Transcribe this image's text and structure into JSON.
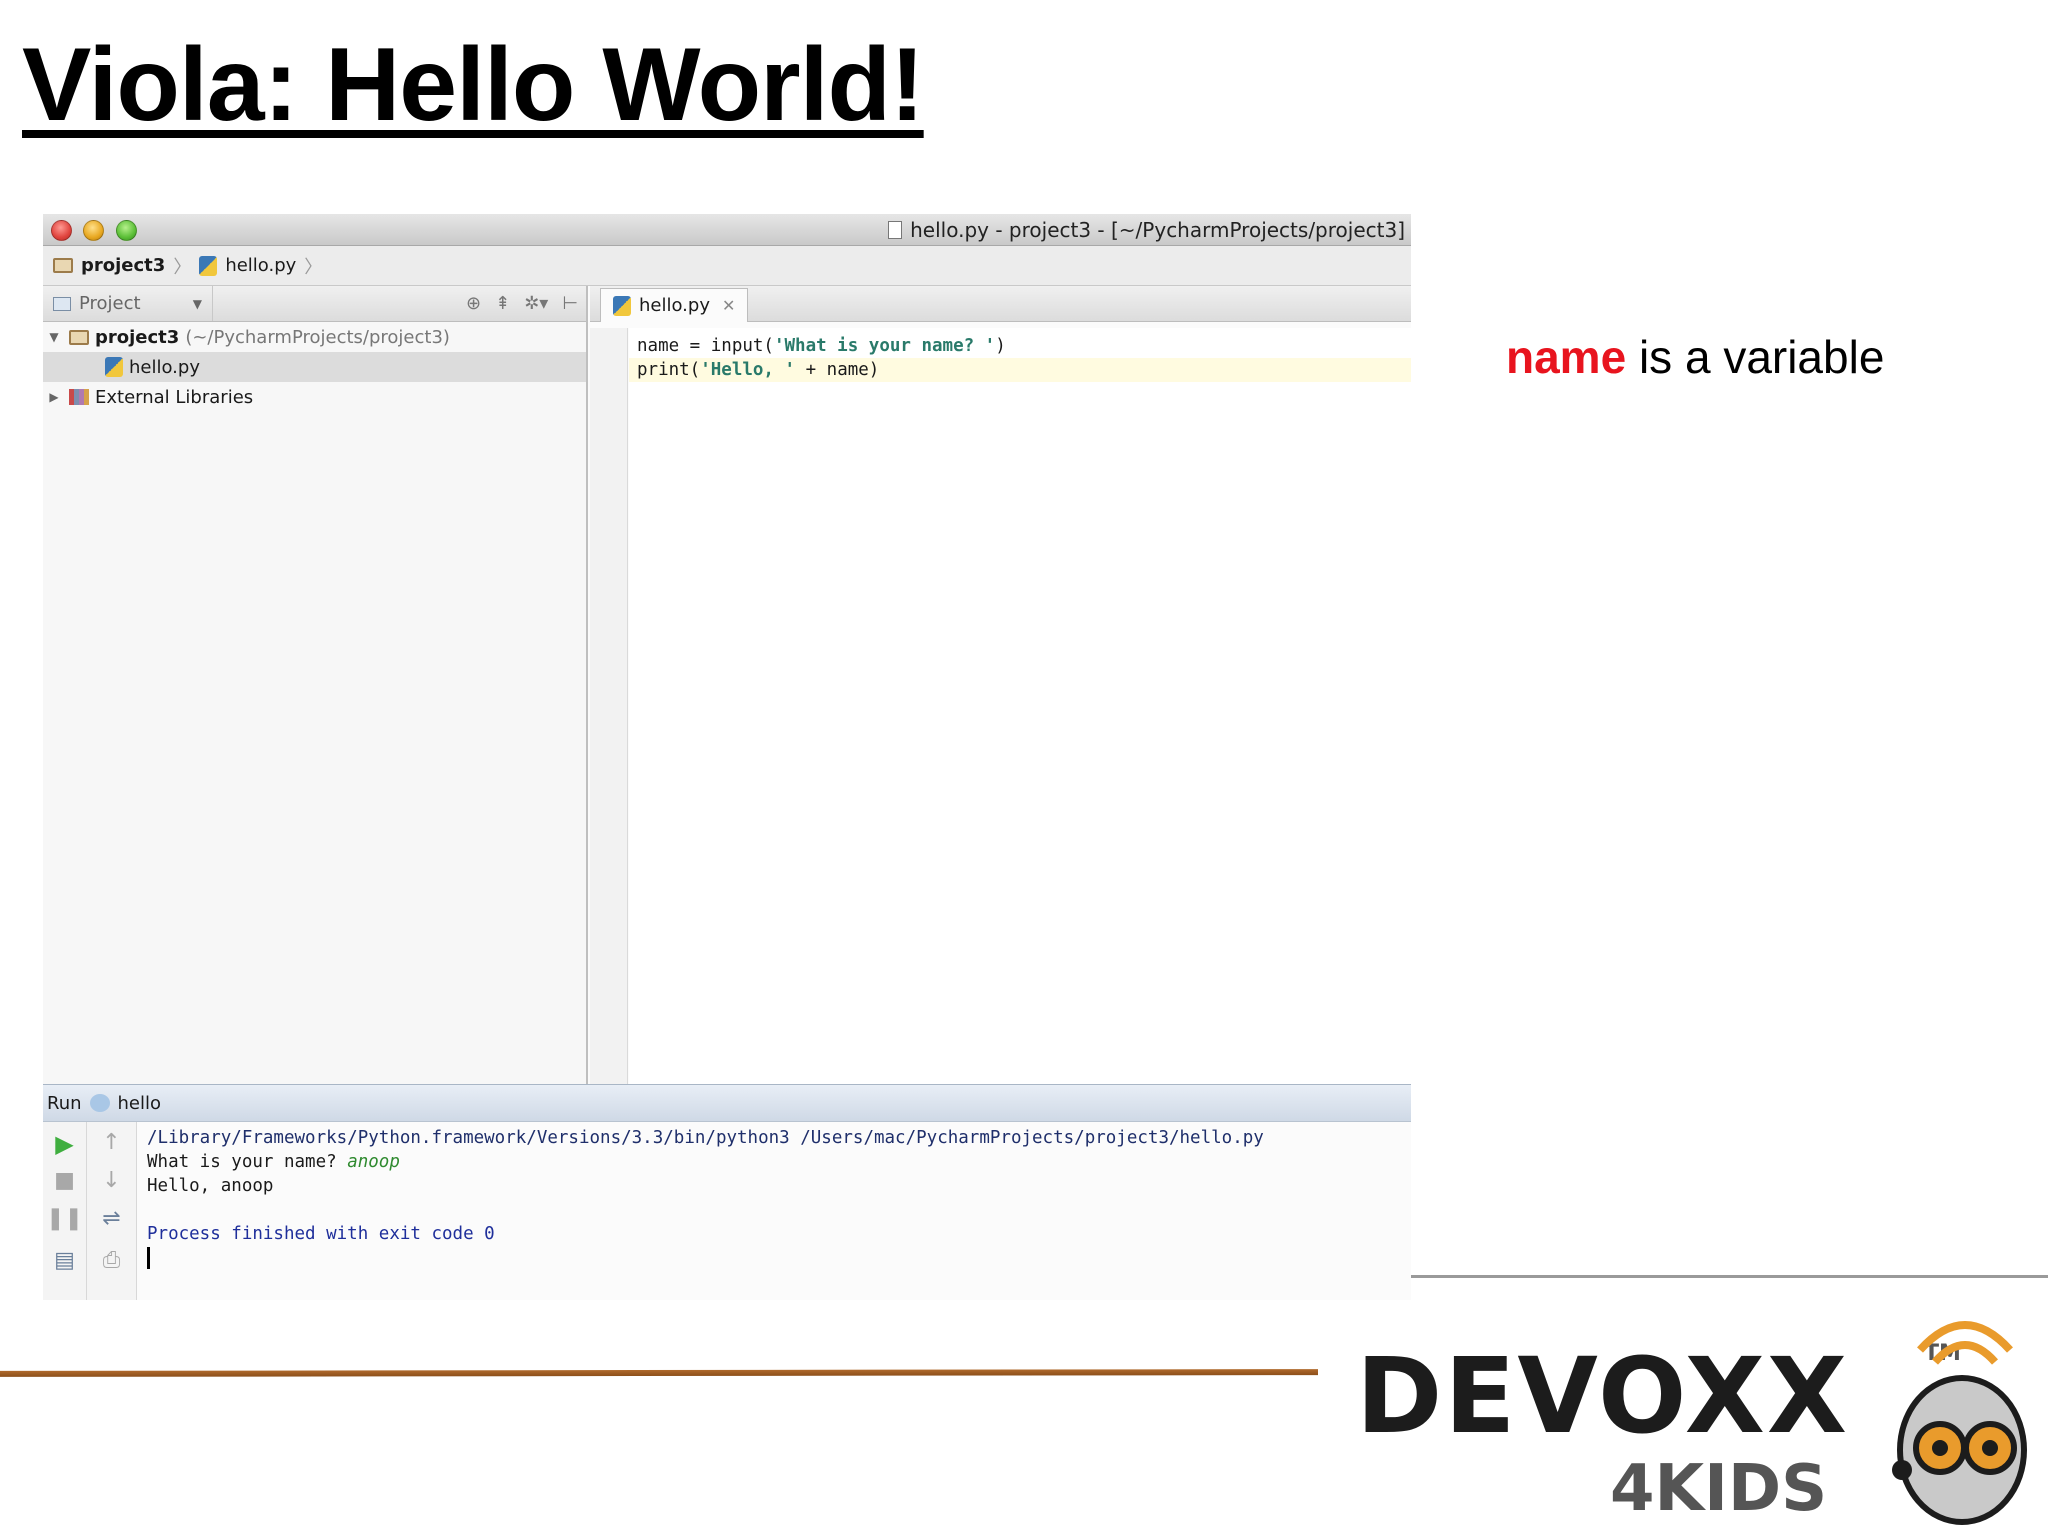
{
  "slide": {
    "title": "Viola: Hello World!",
    "note_keyword": "name",
    "note_rest": " is a variable"
  },
  "window": {
    "title": "hello.py - project3 - [~/PycharmProjects/project3]"
  },
  "breadcrumb": {
    "project": "project3",
    "file": "hello.py"
  },
  "project_pane": {
    "view_label": "Project",
    "tree": {
      "root_name": "project3",
      "root_path": "(~/PycharmProjects/project3)",
      "file": "hello.py",
      "libraries": "External Libraries"
    }
  },
  "editor": {
    "tab_label": "hello.py",
    "lines": [
      {
        "pre": "name = input(",
        "str": "'What is your name? '",
        "post": ")"
      },
      {
        "pre": "print(",
        "str": "'Hello, '",
        "post": " + name)"
      }
    ]
  },
  "run": {
    "label": "Run",
    "config": "hello",
    "console": {
      "command": "/Library/Frameworks/Python.framework/Versions/3.3/bin/python3 /Users/mac/PycharmProjects/project3/hello.py",
      "prompt": "What is your name? ",
      "input": "anoop",
      "output": "Hello, anoop",
      "exit": "Process finished with exit code 0"
    }
  },
  "logo": {
    "main": "DEVOXX",
    "sub": "4KIDS",
    "tm": "TM"
  },
  "colors": {
    "accent_red": "#e8141e",
    "footer_rule": "#a05f24",
    "logo_orange": "#e99b2c"
  }
}
